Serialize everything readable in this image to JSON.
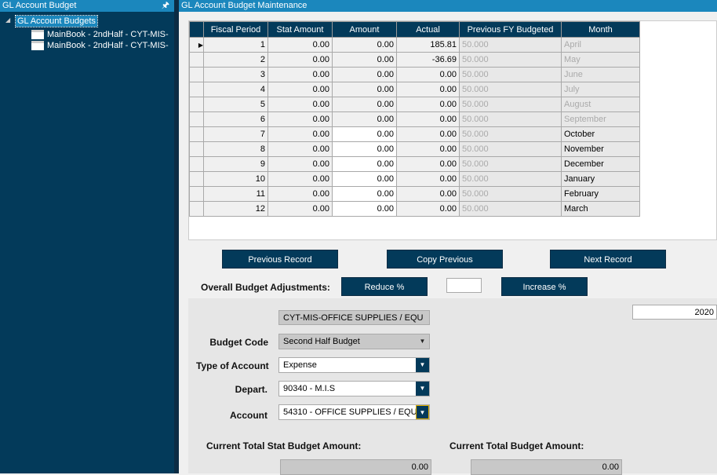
{
  "left_panel": {
    "title": "GL Account Budget",
    "root": "GL Account Budgets",
    "items": [
      "MainBook - 2ndHalf - CYT-MIS-",
      "MainBook - 2ndHalf - CYT-MIS-"
    ]
  },
  "right_panel": {
    "title": "GL Account Budget Maintenance"
  },
  "table": {
    "columns": [
      "Fiscal Period",
      "Stat Amount",
      "Amount",
      "Actual",
      "Previous FY Budgeted",
      "Month"
    ],
    "rows": [
      [
        "1",
        "0.00",
        "0.00",
        "185.81",
        "50.000",
        "April"
      ],
      [
        "2",
        "0.00",
        "0.00",
        "-36.69",
        "50.000",
        "May"
      ],
      [
        "3",
        "0.00",
        "0.00",
        "0.00",
        "50.000",
        "June"
      ],
      [
        "4",
        "0.00",
        "0.00",
        "0.00",
        "50.000",
        "July"
      ],
      [
        "5",
        "0.00",
        "0.00",
        "0.00",
        "50.000",
        "August"
      ],
      [
        "6",
        "0.00",
        "0.00",
        "0.00",
        "50.000",
        "September"
      ],
      [
        "7",
        "0.00",
        "0.00",
        "0.00",
        "50.000",
        "October"
      ],
      [
        "8",
        "0.00",
        "0.00",
        "0.00",
        "50.000",
        "November"
      ],
      [
        "9",
        "0.00",
        "0.00",
        "0.00",
        "50.000",
        "December"
      ],
      [
        "10",
        "0.00",
        "0.00",
        "0.00",
        "50.000",
        "January"
      ],
      [
        "11",
        "0.00",
        "0.00",
        "0.00",
        "50.000",
        "February"
      ],
      [
        "12",
        "0.00",
        "0.00",
        "0.00",
        "50.000",
        "March"
      ]
    ]
  },
  "buttons": {
    "previous": "Previous Record",
    "copy": "Copy Previous",
    "next": "Next Record",
    "reduce": "Reduce %",
    "increase": "Increase %"
  },
  "adjust": {
    "label": "Overall Budget Adjustments:",
    "value": ""
  },
  "form": {
    "year": "2020",
    "account_name": "CYT-MIS-OFFICE SUPPLIES / EQU",
    "budget_code_label": "Budget Code",
    "budget_code": "Second Half Budget",
    "type_label": "Type of Account",
    "type": "Expense",
    "depart_label": "Depart.",
    "depart": "90340 - M.I.S",
    "account_label": "Account",
    "account": "54310 - OFFICE SUPPLIES / EQU",
    "stat_total_label": "Current Total Stat Budget Amount:",
    "stat_total": "0.00",
    "budget_total_label": "Current Total Budget Amount:",
    "budget_total": "0.00"
  }
}
